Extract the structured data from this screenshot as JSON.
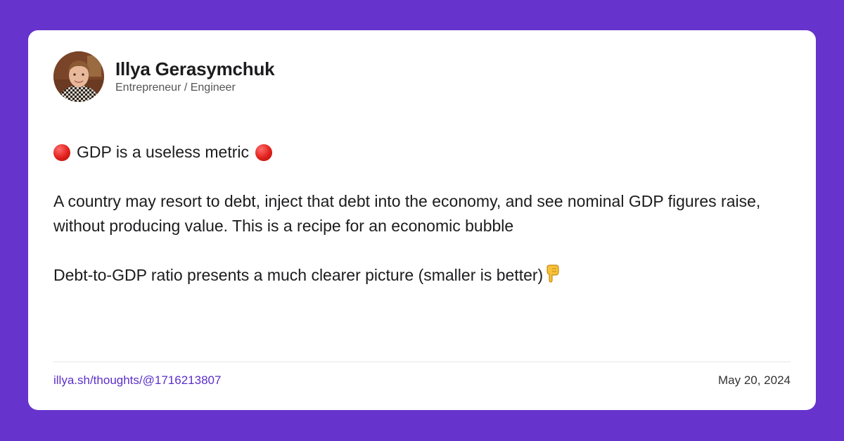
{
  "author": {
    "name": "Illya Gerasymchuk",
    "role": "Entrepreneur / Engineer"
  },
  "post": {
    "headline": "GDP is a useless metric",
    "headline_icon": "red-circle-icon",
    "paragraph_1": "A country may resort to debt, inject that debt into the economy, and see nominal GDP figures raise, without producing value. This is a recipe for an economic bubble",
    "paragraph_2": "Debt-to-GDP ratio presents a much clearer picture (smaller is better)",
    "paragraph_2_icon": "pointing-down-icon"
  },
  "footer": {
    "link": "illya.sh/thoughts/@1716213807",
    "date": "May 20, 2024"
  },
  "colors": {
    "background": "#6633cc",
    "card": "#ffffff",
    "link": "#5b2fc9",
    "accent_red": "#e0201b"
  }
}
